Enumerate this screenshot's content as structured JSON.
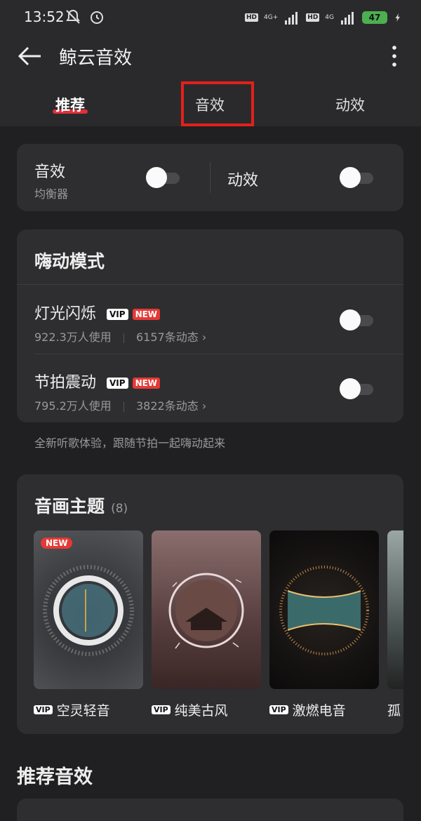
{
  "status": {
    "time": "13:52",
    "battery": "47",
    "hd": "HD",
    "net1": "4G+",
    "net2": "4G"
  },
  "header": {
    "title": "鲸云音效",
    "tabs": [
      "推荐",
      "音效",
      "动效"
    ]
  },
  "quick": {
    "sound_label": "音效",
    "sound_sub": "均衡器",
    "motion_label": "动效"
  },
  "party": {
    "title": "嗨动模式",
    "items": [
      {
        "name": "灯光闪烁",
        "vip": "VIP",
        "new": "NEW",
        "users": "922.3万人使用",
        "posts": "6157条动态"
      },
      {
        "name": "节拍震动",
        "vip": "VIP",
        "new": "NEW",
        "users": "795.2万人使用",
        "posts": "3822条动态"
      }
    ],
    "caption": "全新听歌体验，跟随节拍一起嗨动起来"
  },
  "theme": {
    "title": "音画主题",
    "count": "(8)",
    "new_badge": "NEW",
    "vip": "VIP",
    "items": [
      {
        "name": "空灵轻音"
      },
      {
        "name": "纯美古风"
      },
      {
        "name": "激燃电音"
      },
      {
        "name": "孤"
      }
    ]
  },
  "recommend": {
    "title": "推荐音效"
  }
}
